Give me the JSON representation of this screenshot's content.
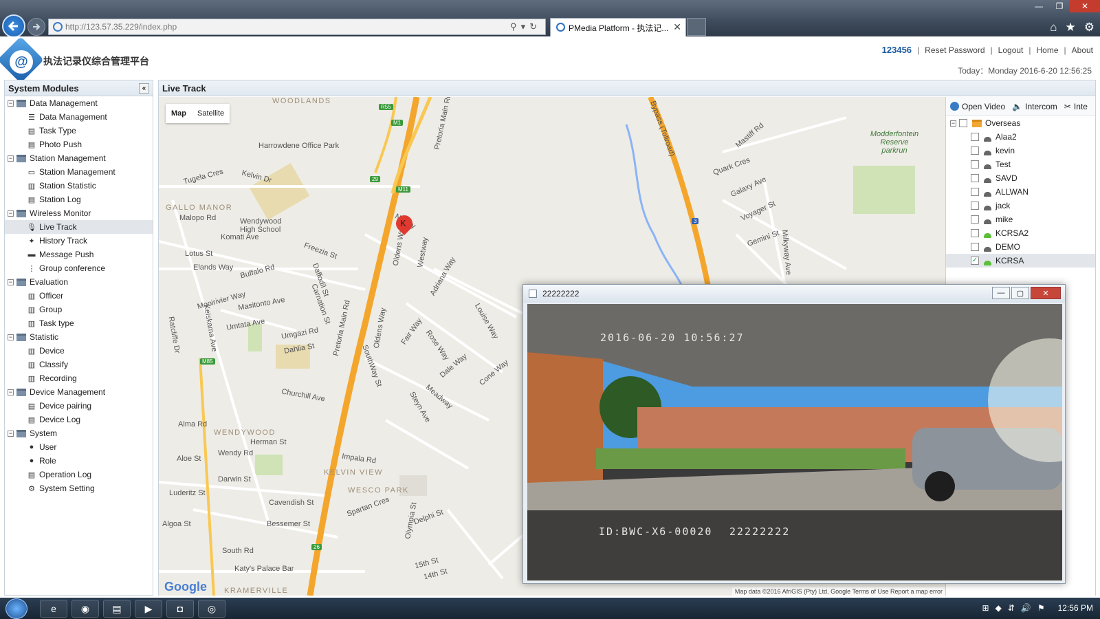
{
  "browser": {
    "url": "http://123.57.35.229/index.php",
    "tab_title": "PMedia Platform - 执法记...",
    "tab_close": "✕"
  },
  "header": {
    "app_title": "执法记录仪综合管理平台",
    "username": "123456",
    "links": [
      "Reset Password",
      "Logout",
      "Home",
      "About"
    ],
    "today": "Today：Monday 2016-6-20 12:56:25"
  },
  "sidebar": {
    "title": "System Modules",
    "groups": [
      {
        "label": "Data Management",
        "items": [
          "Data Management",
          "Task Type",
          "Photo Push"
        ]
      },
      {
        "label": "Station Management",
        "items": [
          "Station Management",
          "Station Statistic",
          "Station Log"
        ]
      },
      {
        "label": "Wireless Monitor",
        "items": [
          "Live Track",
          "History Track",
          "Message Push",
          "Group conference"
        ]
      },
      {
        "label": "Evaluation",
        "items": [
          "Officer",
          "Group",
          "Task type"
        ]
      },
      {
        "label": "Statistic",
        "items": [
          "Device",
          "Classify",
          "Recording"
        ]
      },
      {
        "label": "Device Management",
        "items": [
          "Device pairing",
          "Device Log"
        ]
      },
      {
        "label": "System",
        "items": [
          "User",
          "Role",
          "Operation Log",
          "System Setting"
        ]
      }
    ],
    "selected_item": "Live Track"
  },
  "main": {
    "title": "Live Track",
    "map_toggle": [
      "Map",
      "Satellite"
    ],
    "marker_label": "K",
    "google_logo": "Google",
    "attribution": "Map data ©2016 AfriGIS (Pty) Ltd, Google    Terms of Use    Report a map error",
    "map_labels": {
      "woodlands": "WOODLANDS",
      "gallo_manor": "GALLO MANOR",
      "wendywood": "WENDYWOOD",
      "kelvin_view": "KELVIN VIEW",
      "wesco_park": "WESCO PARK",
      "kramerville": "KRAMERVILLE",
      "harrowdene": "Harrowdene Office Park",
      "modderfontein": "Modderfontein Reserve parkrun",
      "wendywood_hs": "Wendywood High School",
      "pretoria_main_1": "Pretoria Main Rd",
      "pretoria_main_2": "Pretoria Main Rd",
      "bypass": "Bypass (Tollroad)",
      "kelvin_dr": "Kelvin Dr",
      "tugela": "Tugela Cres",
      "malopo": "Malopo Rd",
      "komati": "Komati Ave",
      "lotus": "Lotus St",
      "elands": "Elands Way",
      "buffalo": "Buffalo Rd",
      "freezia": "Freezia St",
      "daffodil": "Daffodil St",
      "mooirivier": "Mooirivier Way",
      "masitonto": "Masitonto Ave",
      "umtata": "Umtata Ave",
      "umgazi": "Umgazi Rd",
      "dahlia": "Dahlia St",
      "churchill": "Churchill Ave",
      "alma": "Alma Rd",
      "herman": "Herman St",
      "wendy_rd": "Wendy Rd",
      "aloe": "Aloe St",
      "darwin": "Darwin St",
      "luderitz": "Luderitz St",
      "cavendish": "Cavendish St",
      "algoa": "Algoa St",
      "bessemer": "Bessemer St",
      "south_rd": "South Rd",
      "impala": "Impala Rd",
      "spartan": "Spartan Cres",
      "delphi": "Delphi St",
      "olympia": "Olympia St",
      "fifteenth": "15th St",
      "fourteenth": "14th St",
      "katys": "Katy's Palace Bar",
      "oldens_way": "Oldens Way",
      "westway": "Westway",
      "adriana": "Adriana Way",
      "fair_way": "Fair Way",
      "rose_way": "Rose Way",
      "dale_way": "Dale Way",
      "cone_way": "Cone Way",
      "louise": "Louise Way",
      "southway": "SouthWay St",
      "meadway": "Meadway",
      "steyn": "Steyn Ave",
      "mastiff": "Mastiff Rd",
      "quark": "Quark Cres",
      "galaxy": "Galaxy Ave",
      "voyager": "Voyager St",
      "gemini": "Gemini St",
      "milkyway": "Milkyway Ave",
      "ratcliffe": "Ratcliffe Dr",
      "keiskama": "Keiskama Ave",
      "carnation": "Carnation St",
      "nw": "N Way",
      "r55": "R55",
      "m1": "M1",
      "m11": "M11",
      "r29": "29",
      "m85": "M85",
      "r3": "3",
      "r26": "26"
    }
  },
  "device_panel": {
    "toolbar": [
      "Open Video",
      "Intercom",
      "Inte"
    ],
    "root": "Overseas",
    "devices": [
      {
        "name": "Alaa2",
        "online": false,
        "checked": false
      },
      {
        "name": "kevin",
        "online": false,
        "checked": false
      },
      {
        "name": "Test",
        "online": false,
        "checked": false
      },
      {
        "name": "SAVD",
        "online": false,
        "checked": false
      },
      {
        "name": "ALLWAN",
        "online": false,
        "checked": false
      },
      {
        "name": "jack",
        "online": false,
        "checked": false
      },
      {
        "name": "mike",
        "online": false,
        "checked": false
      },
      {
        "name": "KCRSA2",
        "online": true,
        "checked": false
      },
      {
        "name": "DEMO",
        "online": false,
        "checked": false
      },
      {
        "name": "KCRSA",
        "online": true,
        "checked": true
      }
    ]
  },
  "video_window": {
    "title": "22222222",
    "osd_datetime": "2016-06-20  10:56:27",
    "osd_id": "ID:BWC-X6-00020",
    "osd_code": "22222222"
  },
  "taskbar": {
    "clock": "12:56 PM"
  },
  "colors": {
    "accent": "#1d5a9e",
    "highway": "#f4a62c",
    "online": "#5bbf3a",
    "offline": "#666666"
  }
}
